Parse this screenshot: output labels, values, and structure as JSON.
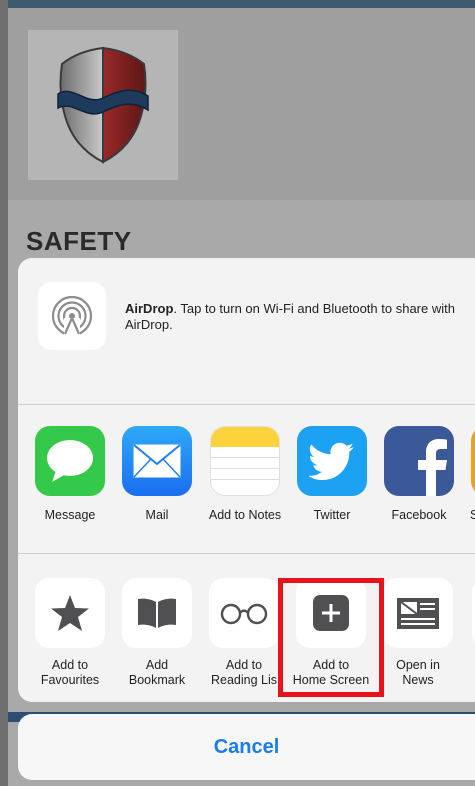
{
  "background": {
    "title": "SAFETY"
  },
  "airdrop": {
    "icon": "airdrop-icon",
    "bold": "AirDrop",
    "message": ". Tap to turn on Wi-Fi and Bluetooth to share with AirDrop."
  },
  "apps": [
    {
      "label": "Message",
      "icon": "messages-icon",
      "color": "#34c759"
    },
    {
      "label": "Mail",
      "icon": "mail-icon",
      "color": "#1f7ef5"
    },
    {
      "label": "Add to Notes",
      "icon": "notes-icon",
      "color": "#ffcc00"
    },
    {
      "label": "Twitter",
      "icon": "twitter-icon",
      "color": "#1da1f2"
    },
    {
      "label": "Facebook",
      "icon": "facebook-icon",
      "color": "#3b5998"
    },
    {
      "label": "S",
      "icon": "partial-app-icon",
      "color": "#f0a020"
    }
  ],
  "actions": [
    {
      "line1": "Add to",
      "line2": "Favourites",
      "icon": "star-icon"
    },
    {
      "line1": "Add",
      "line2": "Bookmark",
      "icon": "book-icon"
    },
    {
      "line1": "Add to",
      "line2": "Reading Lis",
      "icon": "glasses-icon"
    },
    {
      "line1": "Add to",
      "line2": "Home Screen",
      "icon": "plus-square-icon"
    },
    {
      "line1": "Open in",
      "line2": "News",
      "icon": "news-icon"
    }
  ],
  "cancel_label": "Cancel",
  "colors": {
    "accent": "#1a7cf2",
    "highlight": "#e8121b"
  }
}
